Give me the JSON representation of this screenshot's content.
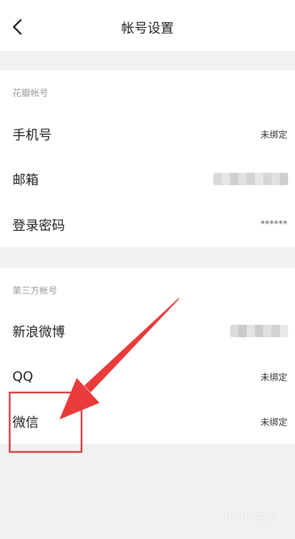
{
  "header": {
    "back_icon": "chevron-left-icon",
    "title": "帐号设置"
  },
  "sections": [
    {
      "title": "花瓣帐号",
      "rows": [
        {
          "label": "手机号",
          "value": "未绑定"
        },
        {
          "label": "邮箱",
          "value": ""
        },
        {
          "label": "登录密码",
          "value": "******"
        }
      ]
    },
    {
      "title": "第三方帐号",
      "rows": [
        {
          "label": "新浪微博",
          "value": ""
        },
        {
          "label": "QQ",
          "value": "未绑定"
        },
        {
          "label": "微信",
          "value": "未绑定"
        }
      ]
    }
  ],
  "annotation": {
    "highlight_color": "#d93a3a",
    "arrow_color": "#ea3b3b"
  },
  "watermark": {
    "text": "Bai 经验"
  }
}
